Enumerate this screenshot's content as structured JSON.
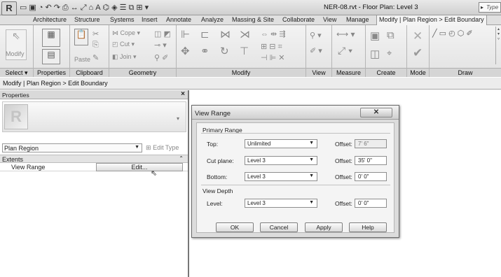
{
  "app": {
    "logo": "R",
    "doc_title": "NER-08.rvt - Floor Plan: Level 3",
    "search_placeholder": "Type"
  },
  "tabs": [
    "Architecture",
    "Structure",
    "Systems",
    "Insert",
    "Annotate",
    "Analyze",
    "Massing & Site",
    "Collaborate",
    "View",
    "Manage",
    "Modify | Plan Region > Edit Boundary"
  ],
  "ribbon": {
    "panels": [
      "Select",
      "Properties",
      "Clipboard",
      "Geometry",
      "Modify",
      "View",
      "Measure",
      "Create",
      "Mode",
      "Draw"
    ],
    "modify_label": "Modify",
    "paste_label": "Paste",
    "cope_label": "Cope",
    "cut_label": "Cut",
    "join_label": "Join"
  },
  "context_bar": "Modify | Plan Region > Edit Boundary",
  "properties": {
    "title": "Properties",
    "close": "×",
    "type_name": "Plan Region",
    "edit_type": "Edit Type",
    "category": "Extents",
    "param_label": "View Range",
    "param_value": "Edit..."
  },
  "dialog": {
    "title": "View Range",
    "close": "✕",
    "primary_range": "Primary Range",
    "view_depth": "View Depth",
    "rows": [
      {
        "label": "Top:",
        "value": "Unlimited",
        "offset_label": "Offset:",
        "offset": "7'  6\"",
        "disabled": true
      },
      {
        "label": "Cut plane:",
        "value": "Level 3",
        "offset_label": "Offset:",
        "offset": "35'  0\"",
        "disabled": false
      },
      {
        "label": "Bottom:",
        "value": "Level 3",
        "offset_label": "Offset:",
        "offset": "0'  0\"",
        "disabled": false
      }
    ],
    "depth_row": {
      "label": "Level:",
      "value": "Level 3",
      "offset_label": "Offset:",
      "offset": "0'  0\""
    },
    "buttons": {
      "ok": "OK",
      "cancel": "Cancel",
      "apply": "Apply",
      "help": "Help"
    }
  }
}
